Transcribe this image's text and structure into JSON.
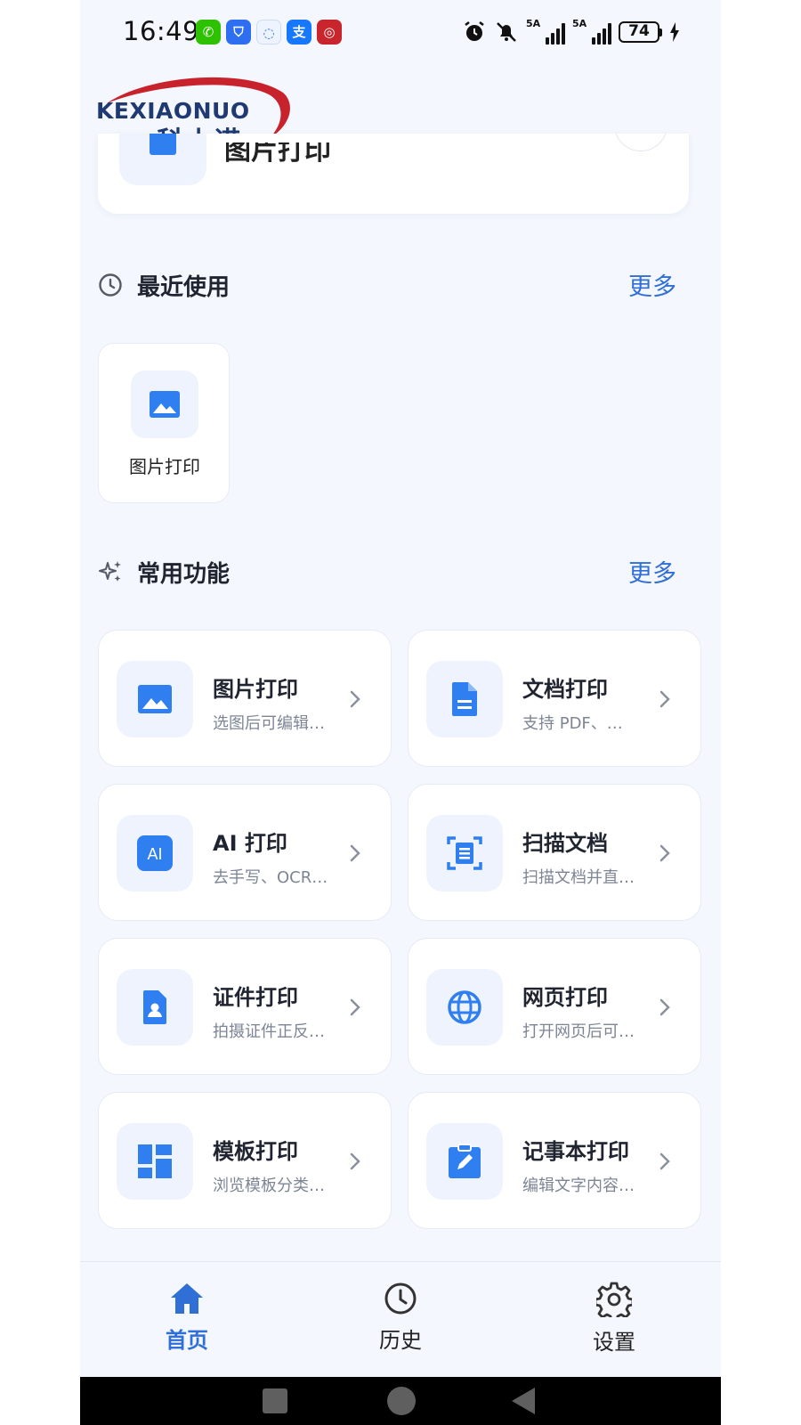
{
  "status_bar": {
    "time": "16:49",
    "apps": [
      {
        "icon": "wechat-icon",
        "color": "#2dc100",
        "glyph": "✆"
      },
      {
        "icon": "security-icon",
        "color": "#2d6ff0",
        "glyph": "⛉"
      },
      {
        "icon": "chat-bubble-icon",
        "color": "#eef4ff",
        "glyph": "◌"
      },
      {
        "icon": "alipay-icon",
        "color": "#1677ff",
        "glyph": "支"
      },
      {
        "icon": "bank-icon",
        "color": "#c9252c",
        "glyph": "◎"
      }
    ],
    "signal_1_label": "5A",
    "signal_2_label": "5A",
    "battery": "74"
  },
  "logo": {
    "text_en": "KEXIAONUO",
    "text_cn": "科小诺"
  },
  "top_card": {
    "title": "图片打印"
  },
  "recent": {
    "title": "最近使用",
    "more": "更多",
    "items": [
      {
        "label": "图片打印",
        "icon": "image-icon"
      }
    ]
  },
  "features": {
    "title": "常用功能",
    "more": "更多",
    "items": [
      {
        "title": "图片打印",
        "subtitle": "选图后可编辑…",
        "icon": "image-icon"
      },
      {
        "title": "文档打印",
        "subtitle": "支持 PDF、…",
        "icon": "document-icon"
      },
      {
        "title": "AI 打印",
        "subtitle": "去手写、OCR…",
        "icon": "ai-icon"
      },
      {
        "title": "扫描文档",
        "subtitle": "扫描文档并直…",
        "icon": "scan-icon"
      },
      {
        "title": "证件打印",
        "subtitle": "拍摄证件正反…",
        "icon": "id-card-icon"
      },
      {
        "title": "网页打印",
        "subtitle": "打开网页后可…",
        "icon": "globe-icon"
      },
      {
        "title": "模板打印",
        "subtitle": "浏览模板分类…",
        "icon": "template-icon"
      },
      {
        "title": "记事本打印",
        "subtitle": "编辑文字内容…",
        "icon": "notepad-icon"
      }
    ]
  },
  "bottom_nav": {
    "items": [
      {
        "label": "首页",
        "icon": "home-icon",
        "active": true
      },
      {
        "label": "历史",
        "icon": "history-icon",
        "active": false
      },
      {
        "label": "设置",
        "icon": "gear-icon",
        "active": false
      }
    ]
  },
  "colors": {
    "accent": "#2f7ff0",
    "active_nav": "#2f6fd6",
    "background": "#f4f7fd",
    "card": "#ffffff",
    "icon_bg": "#eef3fd"
  }
}
